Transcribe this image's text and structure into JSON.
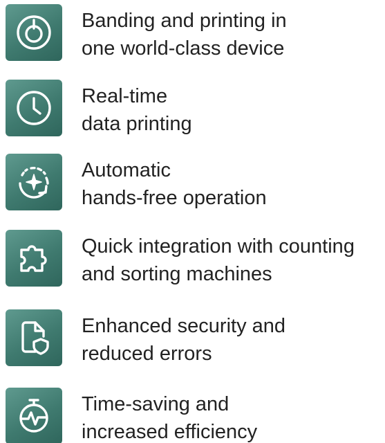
{
  "features": [
    {
      "icon": "power-circle-icon",
      "line1": "Banding and printing in",
      "line2": "one world-class device"
    },
    {
      "icon": "clock-icon",
      "line1": "Real-time",
      "line2": "data printing"
    },
    {
      "icon": "auto-cycle-icon",
      "line1": "Automatic",
      "line2": "hands-free operation"
    },
    {
      "icon": "puzzle-icon",
      "line1": "Quick integration with counting",
      "line2": "and sorting machines"
    },
    {
      "icon": "document-shield-icon",
      "line1": "Enhanced security and",
      "line2": "reduced errors"
    },
    {
      "icon": "stopwatch-icon",
      "line1": "Time-saving and",
      "line2": "increased efficiency"
    }
  ],
  "colors": {
    "tile": "#3f7a6f",
    "text": "#222222",
    "icon": "#ffffff"
  }
}
